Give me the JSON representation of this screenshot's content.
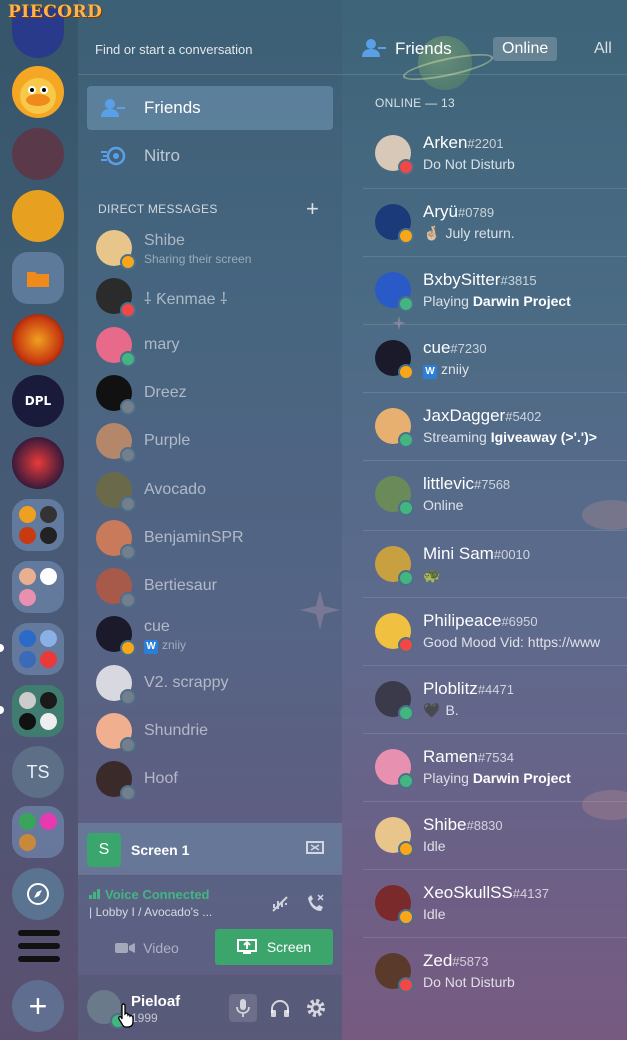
{
  "brand": "PIECORD",
  "search": {
    "placeholder": "Find or start a conversation"
  },
  "nav": {
    "friends": "Friends",
    "nitro": "Nitro"
  },
  "dm_header": "DIRECT MESSAGES",
  "dms": [
    {
      "name": "Shibe",
      "sub": "Sharing their screen",
      "status": "idle",
      "color": "#e8c58a"
    },
    {
      "name": "⸸ Ƙenmae ⸸",
      "sub": "",
      "status": "dnd",
      "color": "#2b2b2b"
    },
    {
      "name": "mary",
      "sub": "",
      "status": "online",
      "color": "#e86a8a"
    },
    {
      "name": "Dreez",
      "sub": "",
      "status": "off",
      "color": "#111111"
    },
    {
      "name": "Purple",
      "sub": "",
      "status": "off",
      "color": "#b5876a"
    },
    {
      "name": "Avocado",
      "sub": "",
      "status": "off",
      "color": "#6a6a4a"
    },
    {
      "name": "BenjaminSPR",
      "sub": "",
      "status": "off",
      "color": "#c87a5a"
    },
    {
      "name": "Bertiesaur",
      "sub": "",
      "status": "off",
      "color": "#a85a4a"
    },
    {
      "name": "cue",
      "sub": "zniiy",
      "sub_badge": "W",
      "status": "idle",
      "color": "#1a1a2a"
    },
    {
      "name": "V2. scrappy",
      "sub": "",
      "status": "off",
      "color": "#d8d8e0"
    },
    {
      "name": "Shundrie",
      "sub": "",
      "status": "off",
      "color": "#f0b090"
    },
    {
      "name": "Hoof",
      "sub": "",
      "status": "off",
      "color": "#3a2a2a"
    }
  ],
  "screen": {
    "title": "Screen 1",
    "icon_letter": "S"
  },
  "voice": {
    "label": "Voice Connected",
    "sub": "| Lobby I / Avocado's ...",
    "video": "Video",
    "screen": "Screen"
  },
  "user": {
    "name": "Pieloaf",
    "tag": "1999"
  },
  "topbar": {
    "friends": "Friends",
    "online": "Online",
    "all": "All"
  },
  "online_header": "ONLINE — 13",
  "friends": [
    {
      "name": "Arken",
      "tag": "#2201",
      "status_text": "Do Not Disturb",
      "status": "dnd",
      "color": "#d8c8b8"
    },
    {
      "name": "Aryü",
      "tag": "#0789",
      "status_text": "July return.",
      "prefix": "🤞🏻",
      "status": "idle",
      "color": "#1a3a7a"
    },
    {
      "name": "BxbySitter",
      "tag": "#3815",
      "status_text": "Playing ",
      "bold": "Darwin Project",
      "status": "online",
      "color": "#2a5ac8"
    },
    {
      "name": "cue",
      "tag": "#7230",
      "status_text": "zniiy",
      "badge": "W",
      "status": "idle",
      "color": "#1a1a2a"
    },
    {
      "name": "JaxDagger",
      "tag": "#5402",
      "status_text": "Streaming ",
      "bold": "Igiveaway (>'.')>",
      "status": "online",
      "color": "#e8b070"
    },
    {
      "name": "littlevic",
      "tag": "#7568",
      "status_text": "Online",
      "status": "online",
      "color": "#6a8a5a"
    },
    {
      "name": "Mini Sam",
      "tag": "#0010",
      "status_text": "🐢",
      "status": "online",
      "color": "#c8a040"
    },
    {
      "name": "Philipeace",
      "tag": "#6950",
      "status_text": "Good Mood Vid: https://www",
      "status": "dnd",
      "color": "#f0c040"
    },
    {
      "name": "Ploblitz",
      "tag": "#4471",
      "status_text": "B.",
      "prefix": "🖤",
      "status": "online",
      "color": "#3a3a4a"
    },
    {
      "name": "Ramen",
      "tag": "#7534",
      "status_text": "Playing ",
      "bold": "Darwin Project",
      "status": "online",
      "color": "#e890b0"
    },
    {
      "name": "Shibe",
      "tag": "#8830",
      "status_text": "Idle",
      "status": "idle",
      "color": "#e8c58a"
    },
    {
      "name": "XeoSkullSS",
      "tag": "#4137",
      "status_text": "Idle",
      "status": "idle",
      "color": "#7a2a2a"
    },
    {
      "name": "Zed",
      "tag": "#5873",
      "status_text": "Do Not Disturb",
      "status": "dnd",
      "color": "#5a3a2a"
    }
  ],
  "servers": [
    {
      "name": "server-stylusbro",
      "color": "#2a3a8a"
    },
    {
      "name": "server-duck",
      "color": "#f5a623"
    },
    {
      "name": "server-streamer",
      "color": "#5a3a4a"
    },
    {
      "name": "server-pikachu-mask",
      "color": "#e8a020"
    },
    {
      "name": "server-fire",
      "color": "#c83a10"
    },
    {
      "name": "server-dpl",
      "color": "#1a1a3a"
    },
    {
      "name": "server-emblem",
      "color": "#3a1a3a"
    }
  ],
  "rail_labels": {
    "ts": "TS"
  }
}
